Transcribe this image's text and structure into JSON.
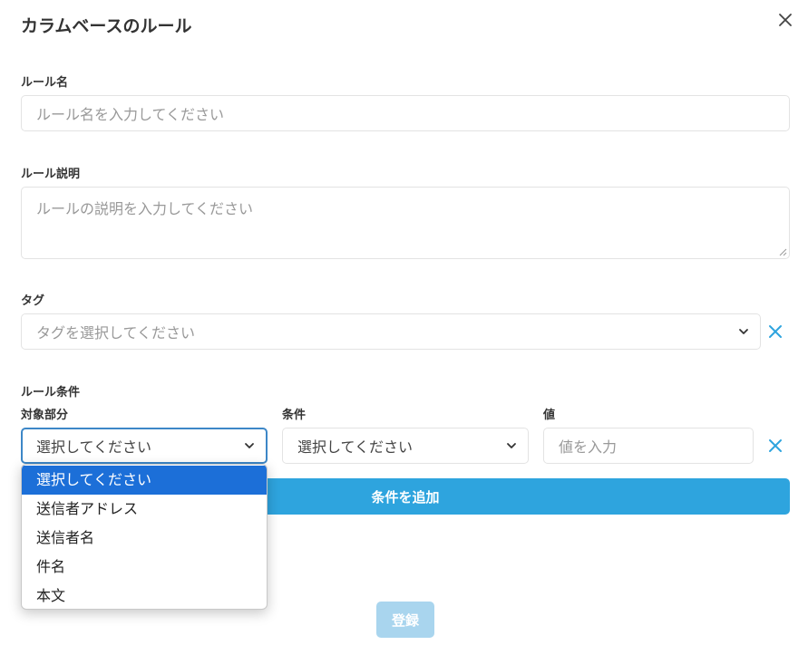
{
  "modal": {
    "title": "カラムベースのルール"
  },
  "rule_name": {
    "label": "ルール名",
    "placeholder": "ルール名を入力してください"
  },
  "rule_description": {
    "label": "ルール説明",
    "placeholder": "ルールの説明を入力してください"
  },
  "tag": {
    "label": "タグ",
    "placeholder": "タグを選択してください"
  },
  "conditions": {
    "label": "ルール条件",
    "target_label": "対象部分",
    "condition_label": "条件",
    "value_label": "値",
    "target_selected": "選択してください",
    "condition_selected": "選択してください",
    "value_placeholder": "値を入力",
    "add_button": "条件を追加"
  },
  "target_options": [
    "選択してください",
    "送信者アドレス",
    "送信者名",
    "件名",
    "本文"
  ],
  "submit_button": "登録",
  "colors": {
    "accent": "#2ea4de",
    "accent_disabled": "#a9d5ee",
    "option_selected": "#1c6fd8",
    "focus_border": "#3d87c7"
  },
  "icons": {
    "close": "close-icon",
    "clear": "x-icon",
    "dropdown": "chevron-down-icon"
  }
}
